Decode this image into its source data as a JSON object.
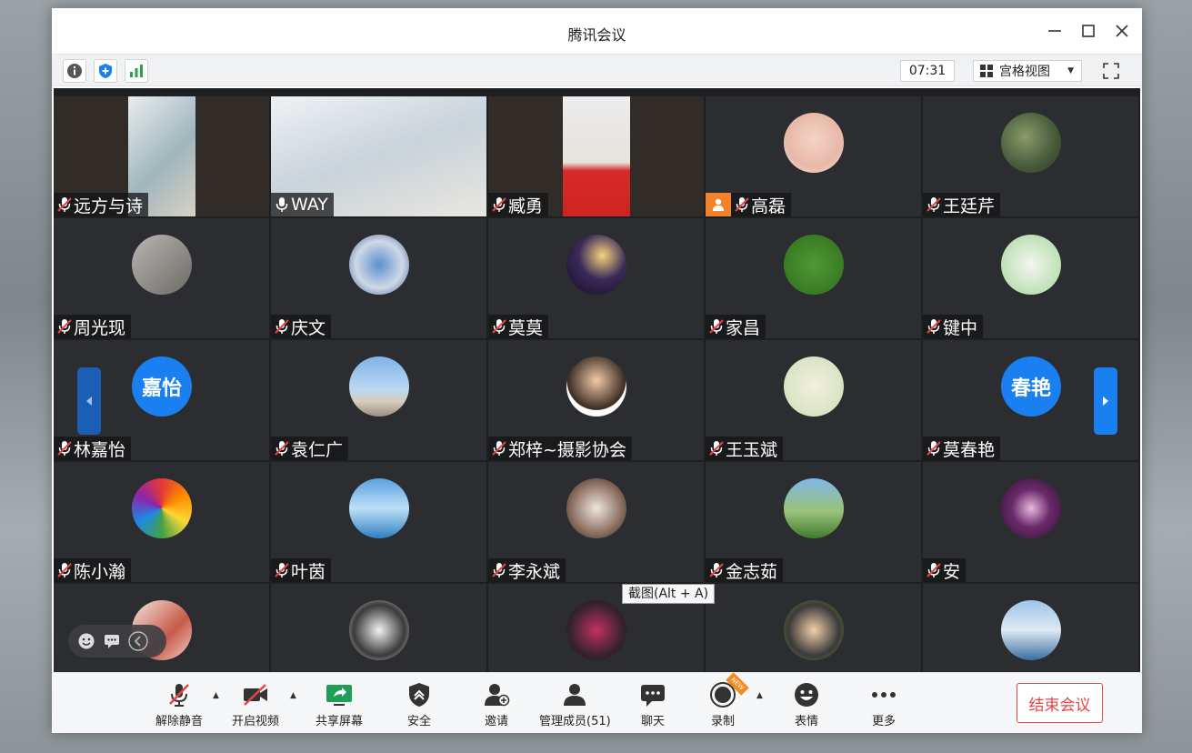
{
  "window": {
    "title": "腾讯会议"
  },
  "toolbar": {
    "timer": "07:31",
    "view_label": "宫格视图"
  },
  "colors": {
    "accent": "#1a7ff0",
    "end": "#e54545",
    "host": "#f2832b",
    "active": "#3fbf6b"
  },
  "participants": [
    {
      "name": "远方与诗",
      "kind": "video",
      "bg": "linear-gradient(135deg,#e9ecef,#9fb6bd 55%,#d9d1c3)"
    },
    {
      "name": "WAY",
      "kind": "video",
      "bg": "linear-gradient(160deg,#eef2f5,#c9d3da 50%,#e9e6e0)",
      "active": true,
      "mic_on": true
    },
    {
      "name": "臧勇",
      "kind": "video",
      "bg": "linear-gradient(180deg,#ececec 0%,#e7e3dc 55%,#d52a2a 62%,#cf2424 100%)"
    },
    {
      "name": "高磊",
      "kind": "avatar",
      "bg": "radial-gradient(circle at 50% 45%,#f4d4c4,#e8b8a8 60%,#f6e7df)",
      "host": true
    },
    {
      "name": "王廷芹",
      "kind": "avatar",
      "bg": "radial-gradient(circle at 40% 40%,#8a9a6a,#465a3a 60%,#2e3a28)"
    },
    {
      "name": "周光现",
      "kind": "avatar",
      "bg": "linear-gradient(135deg,#b9b6b2,#6d6a66)"
    },
    {
      "name": "庆文",
      "kind": "avatar",
      "bg": "radial-gradient(circle,#5b8fd0,#cfd8e6 55%,#3d5f99)"
    },
    {
      "name": "莫莫",
      "kind": "avatar",
      "bg": "radial-gradient(circle at 60% 35%,#f8d37a,#3a2a5a 45%,#120d1e)"
    },
    {
      "name": "家昌",
      "kind": "avatar",
      "bg": "radial-gradient(circle,#4f9a33,#2f6d1f)"
    },
    {
      "name": "键中",
      "kind": "avatar",
      "bg": "radial-gradient(circle,#f2f6ef,#bfe0b5 70%,#8fc07f)"
    },
    {
      "name": "林嘉怡",
      "kind": "text",
      "avatar_text": "嘉怡"
    },
    {
      "name": "袁仁广",
      "kind": "avatar",
      "bg": "linear-gradient(180deg,#7fb3e8 0%,#bcd8f2 55%,#d7ccba 75%,#9a8f80 100%)"
    },
    {
      "name": "郑梓~摄影协会",
      "kind": "avatar",
      "bg": "radial-gradient(circle at 50% 40%,#f0c9a8,#3a2a22 62%,#ffffff 64%)"
    },
    {
      "name": "王玉斌",
      "kind": "avatar",
      "bg": "radial-gradient(circle,#f3efe1,#d8e4c3 70%,#9bbd7d)"
    },
    {
      "name": "莫春艳",
      "kind": "text",
      "avatar_text": "春艳"
    },
    {
      "name": "陈小瀚",
      "kind": "avatar",
      "bg": "conic-gradient(#e53935,#fb8c00,#fdd835,#43a047,#1e88e5,#8e24aa,#e53935)"
    },
    {
      "name": "叶茵",
      "kind": "avatar",
      "bg": "linear-gradient(180deg,#5aa0e0 0%,#bde0f7 50%,#2f7fc2 100%)"
    },
    {
      "name": "李永斌",
      "kind": "avatar",
      "bg": "radial-gradient(circle,#efe6de,#8a6e60 60%,#2a2221)"
    },
    {
      "name": "金志茹",
      "kind": "avatar",
      "bg": "linear-gradient(180deg,#7fb7e6 0%,#9ac27a 55%,#3f7a2d 100%)"
    },
    {
      "name": "安",
      "kind": "avatar",
      "bg": "radial-gradient(circle,#e6b8e0,#6b2a6a 45%,#2a1230)"
    },
    {
      "name": "",
      "kind": "avatar",
      "bg": "linear-gradient(135deg,#f5e5df,#c75a4a 60%,#f2d0c5)"
    },
    {
      "name": "",
      "kind": "avatar",
      "bg": "radial-gradient(circle,#f2f2f2,#3a3a3a 60%,#dcdcdc)"
    },
    {
      "name": "",
      "kind": "avatar",
      "bg": "radial-gradient(circle,#c23060,#3a2330 60%,#1c1016)"
    },
    {
      "name": "",
      "kind": "avatar",
      "bg": "radial-gradient(circle,#f4cfa9,#3a3a3a 60%,#6a8a2a)"
    },
    {
      "name": "",
      "kind": "avatar",
      "bg": "linear-gradient(180deg,#9ec3ea 0%,#dfe9f2 50%,#3a6fa0 100%)"
    }
  ],
  "tooltip": {
    "text": "截图(Alt + A)"
  },
  "bottom": {
    "unmute": "解除静音",
    "video": "开启视频",
    "share": "共享屏幕",
    "security": "安全",
    "invite": "邀请",
    "members": "管理成员(51)",
    "chat": "聊天",
    "record": "录制",
    "reactions": "表情",
    "more": "更多",
    "end": "结束会议",
    "new_badge": "NEW"
  }
}
